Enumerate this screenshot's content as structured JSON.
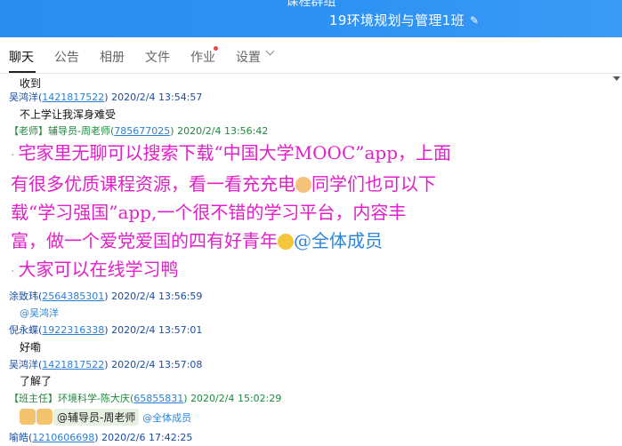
{
  "header": {
    "title_top": "课程群组",
    "title": "19环境规划与管理1班",
    "edit_icon": "edit-icon"
  },
  "tabs": [
    {
      "label": "聊天"
    },
    {
      "label": "公告"
    },
    {
      "label": "相册"
    },
    {
      "label": "文件"
    },
    {
      "label": "作业"
    },
    {
      "label": "设置"
    }
  ],
  "messages": {
    "m0": {
      "text": "收到"
    },
    "m1": {
      "name": "吴鸿洋",
      "id": "1421817522",
      "time": "2020/2/4 13:54:57",
      "text": "不上学让我浑身难受"
    },
    "m2": {
      "tag": "【老师】",
      "name": "辅导员-周老师",
      "id": "785677025",
      "time": "2020/2/4 13:56:42",
      "lines": [
        "宅家里无聊可以搜索下载“中国大学MOOC”app，上面",
        "有很多优质课程资源，看一看充充电",
        "同学们也可以下",
        "载“学习强国”app,一个很不错的学习平台，内容丰",
        "富，做一个爱党爱国的四有好青年",
        "@全体成员",
        "大家可以在线学习鸭"
      ]
    },
    "m3": {
      "name": "涂致玮",
      "id": "2564385301",
      "time": "2020/2/4 13:56:59",
      "text": "@吴鸿洋"
    },
    "m4": {
      "name": "倪永蝶",
      "id": "1922316338",
      "time": "2020/2/4 13:57:01",
      "text": "好嘞"
    },
    "m5": {
      "name": "吴鸿洋",
      "id": "1421817522",
      "time": "2020/2/4 13:57:08",
      "text": "了解了"
    },
    "m6": {
      "tag": "【班主任】",
      "name": "环境科学-陈大庆",
      "id": "65855831",
      "time": "2020/2/4 15:02:29",
      "mention1": "@辅导员-周老师",
      "mention2": "@全体成员"
    },
    "m7": {
      "name": "喻皓",
      "id": "1210606698",
      "time": "2020/2/6 17:42:25"
    }
  }
}
